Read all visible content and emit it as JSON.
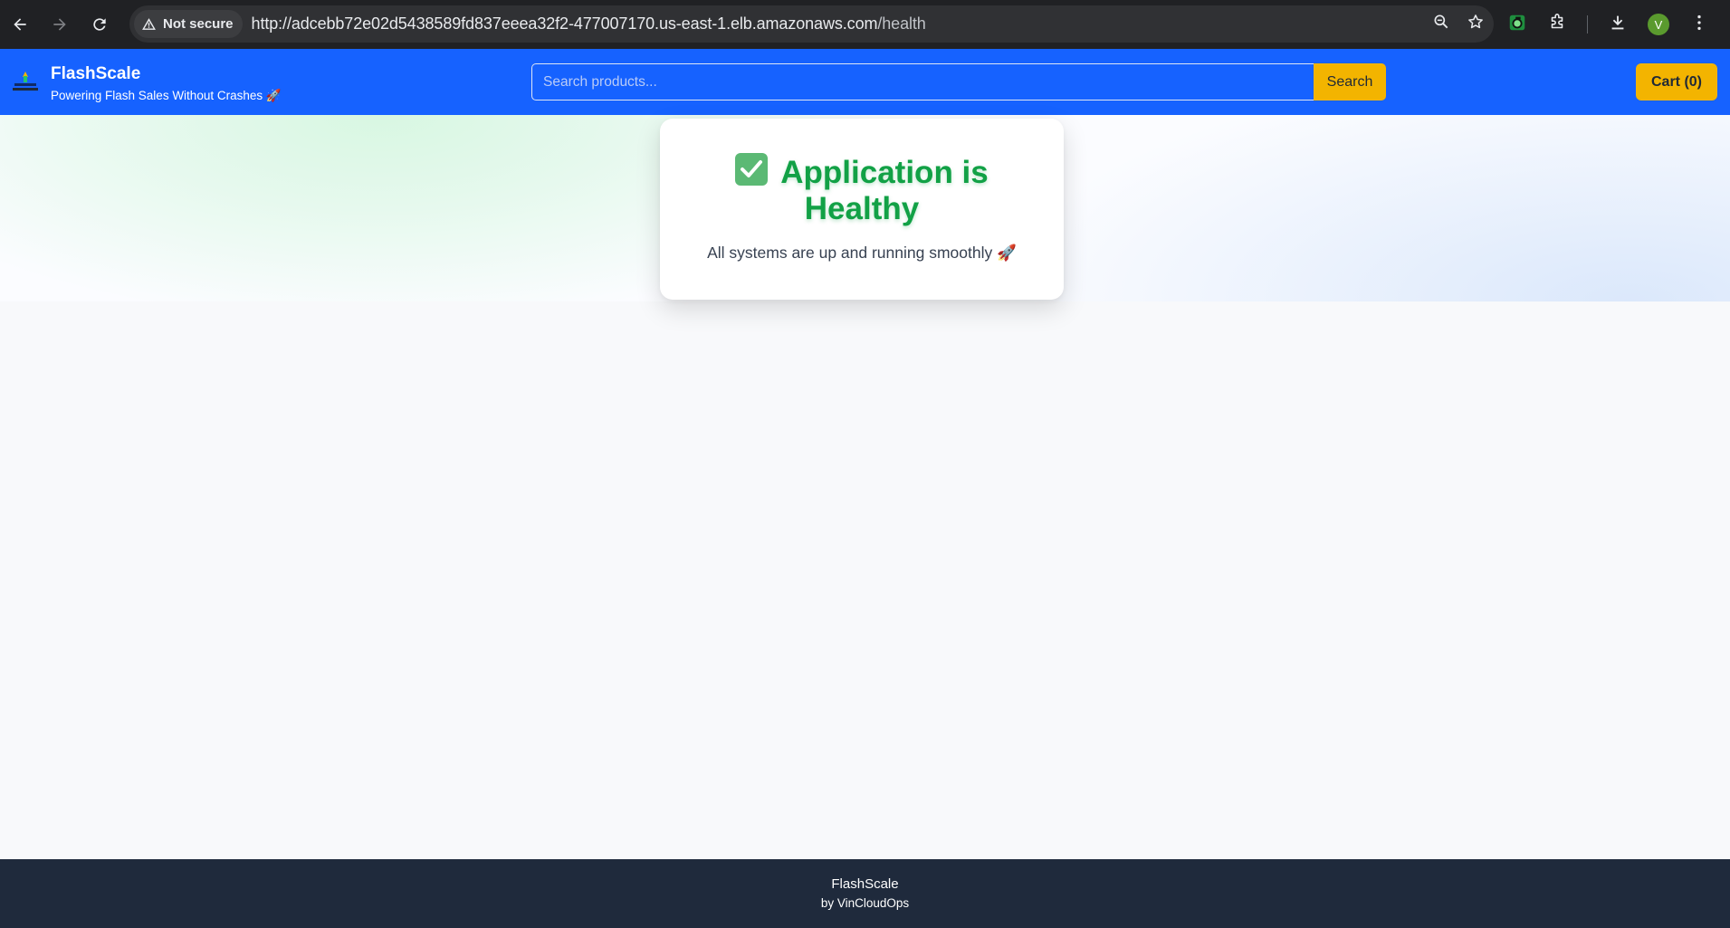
{
  "browser": {
    "security_label": "Not secure",
    "url_main": "http://adcebb72e02d5438589fd837eeea32f2-477007170.us-east-1.elb.amazonaws.com",
    "url_path": "/health",
    "profile_initial": "V"
  },
  "header": {
    "brand_name": "FlashScale",
    "tagline": "Powering Flash Sales Without Crashes 🚀",
    "search_placeholder": "Search products...",
    "search_label": "Search",
    "cart_label": "Cart (0)"
  },
  "status_card": {
    "title": "Application is Healthy",
    "subtitle": "All systems are up and running smoothly 🚀"
  },
  "footer": {
    "name": "FlashScale",
    "by": "by VinCloudOps"
  },
  "colors": {
    "header_blue": "#1662ff",
    "accent_yellow": "#f3b400",
    "healthy_green": "#12a146",
    "footer_navy": "#1f2a3c"
  }
}
